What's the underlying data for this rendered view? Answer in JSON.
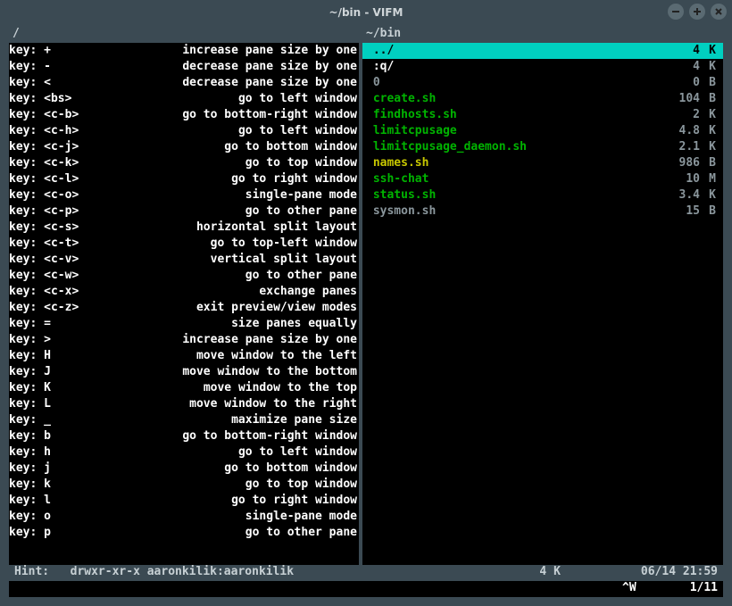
{
  "window": {
    "title": "~/bin - VIFM"
  },
  "panes": {
    "left_path": "/",
    "right_path": "~/bin"
  },
  "keybindings": [
    {
      "key": "+",
      "desc": "increase pane size by one"
    },
    {
      "key": "-",
      "desc": "decrease pane size by one"
    },
    {
      "key": "<",
      "desc": "decrease pane size by one"
    },
    {
      "key": "<bs>",
      "desc": "go to left window"
    },
    {
      "key": "<c-b>",
      "desc": "go to bottom-right window"
    },
    {
      "key": "<c-h>",
      "desc": "go to left window"
    },
    {
      "key": "<c-j>",
      "desc": "go to bottom window"
    },
    {
      "key": "<c-k>",
      "desc": "go to top window"
    },
    {
      "key": "<c-l>",
      "desc": "go to right window"
    },
    {
      "key": "<c-o>",
      "desc": "single-pane mode"
    },
    {
      "key": "<c-p>",
      "desc": "go to other pane"
    },
    {
      "key": "<c-s>",
      "desc": "horizontal split layout"
    },
    {
      "key": "<c-t>",
      "desc": "go to top-left window"
    },
    {
      "key": "<c-v>",
      "desc": "vertical split layout"
    },
    {
      "key": "<c-w>",
      "desc": "go to other pane"
    },
    {
      "key": "<c-x>",
      "desc": "exchange panes"
    },
    {
      "key": "<c-z>",
      "desc": "exit preview/view modes"
    },
    {
      "key": "=",
      "desc": "size panes equally"
    },
    {
      "key": ">",
      "desc": "increase pane size by one"
    },
    {
      "key": "H",
      "desc": "move window to the left"
    },
    {
      "key": "J",
      "desc": "move window to the bottom"
    },
    {
      "key": "K",
      "desc": "move window to the top"
    },
    {
      "key": "L",
      "desc": "move window to the right"
    },
    {
      "key": "_",
      "desc": "maximize pane size"
    },
    {
      "key": "b",
      "desc": "go to bottom-right window"
    },
    {
      "key": "h",
      "desc": "go to left window"
    },
    {
      "key": "j",
      "desc": "go to bottom window"
    },
    {
      "key": "k",
      "desc": "go to top window"
    },
    {
      "key": "l",
      "desc": "go to right window"
    },
    {
      "key": "o",
      "desc": "single-pane mode"
    },
    {
      "key": "p",
      "desc": "go to other pane"
    }
  ],
  "files": [
    {
      "name": "../",
      "size": "4",
      "unit": "K",
      "color": "white",
      "selected": true
    },
    {
      "name": ":q/",
      "size": "4",
      "unit": "K",
      "color": "white",
      "selected": false
    },
    {
      "name": "0",
      "size": "0",
      "unit": "B",
      "color": "gray",
      "selected": false
    },
    {
      "name": "create.sh",
      "size": "104",
      "unit": "B",
      "color": "green",
      "selected": false
    },
    {
      "name": "findhosts.sh",
      "size": "2",
      "unit": "K",
      "color": "green",
      "selected": false
    },
    {
      "name": "limitcpusage",
      "size": "4.8",
      "unit": "K",
      "color": "green",
      "selected": false
    },
    {
      "name": "limitcpusage_daemon.sh",
      "size": "2.1",
      "unit": "K",
      "color": "green",
      "selected": false
    },
    {
      "name": "names.sh",
      "size": "986",
      "unit": "B",
      "color": "yellow",
      "selected": false
    },
    {
      "name": "ssh-chat",
      "size": "10",
      "unit": "M",
      "color": "green",
      "selected": false
    },
    {
      "name": "status.sh",
      "size": "3.4",
      "unit": "K",
      "color": "green",
      "selected": false
    },
    {
      "name": "sysmon.sh",
      "size": "15",
      "unit": "B",
      "color": "gray",
      "selected": false
    }
  ],
  "status": {
    "hint": "Hint:",
    "perms": "drwxr-xr-x aaronkilik:aaronkilik",
    "size": "4 K",
    "date": "06/14 21:59"
  },
  "cmdline": {
    "indicator": "^W",
    "position": "1/11"
  }
}
